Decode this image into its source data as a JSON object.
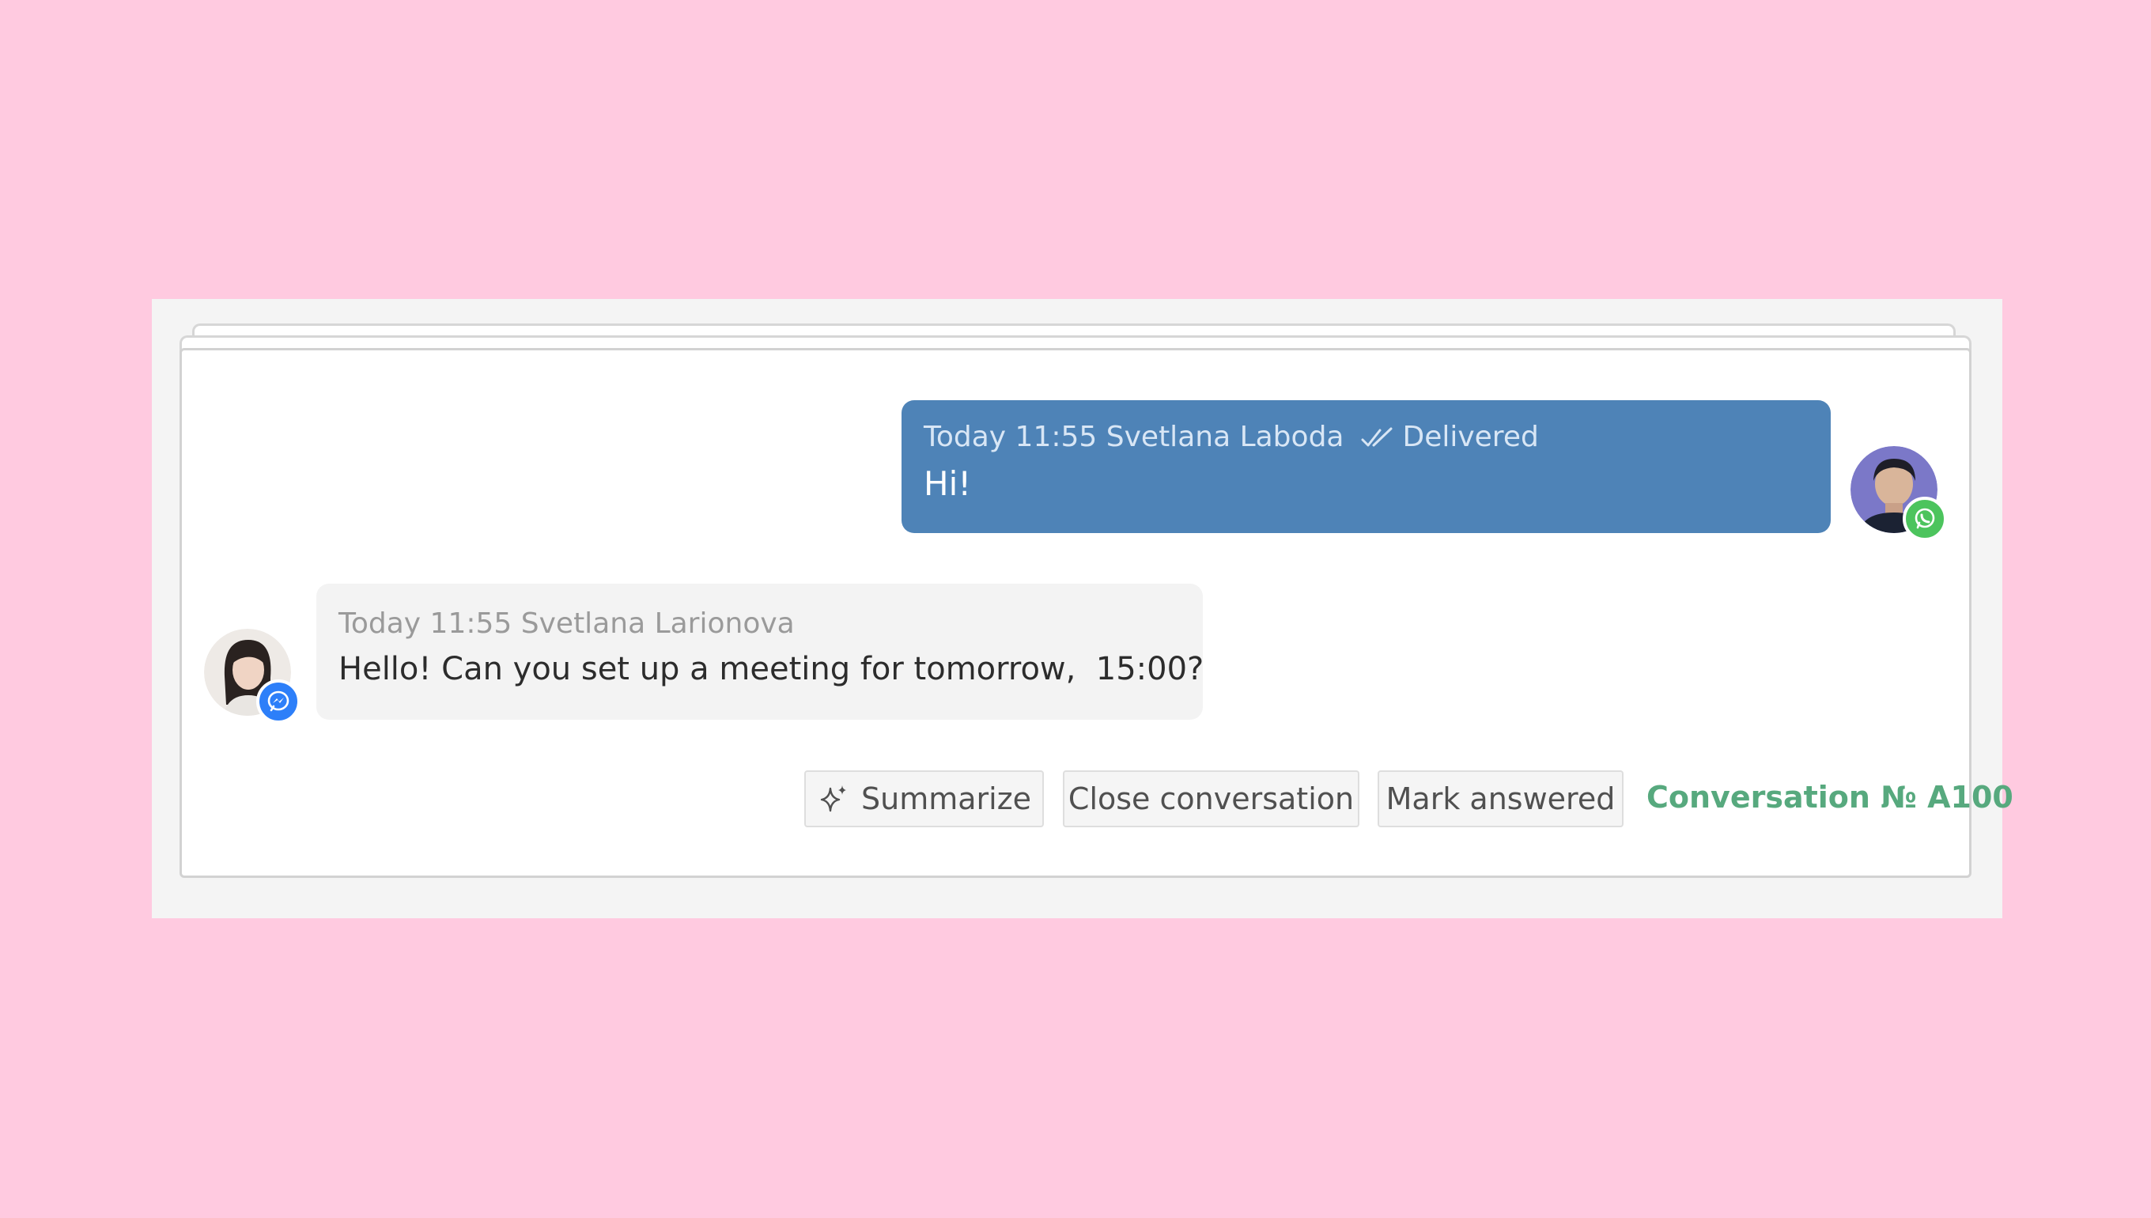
{
  "messages": {
    "outgoing": {
      "timestamp": "Today 11:55",
      "sender": "Svetlana Laboda",
      "status": "Delivered",
      "text": "Hi!",
      "channel_icon": "whatsapp-icon"
    },
    "incoming": {
      "timestamp": "Today 11:55",
      "sender": "Svetlana Larionova",
      "text": "Hello! Can you set up a meeting for tomorrow,  15:00?",
      "channel_icon": "messenger-icon"
    }
  },
  "actions": {
    "summarize_label": "Summarize",
    "close_label": "Close conversation",
    "mark_answered_label": "Mark answered",
    "conversation_link": "Conversation № A100"
  },
  "colors": {
    "background": "#ffcae0",
    "outgoing_bubble": "#4e83b7",
    "incoming_bubble": "#f3f3f3",
    "link_green": "#57a97e",
    "whatsapp_green": "#4cc45d",
    "messenger_blue": "#2d7ff9"
  }
}
